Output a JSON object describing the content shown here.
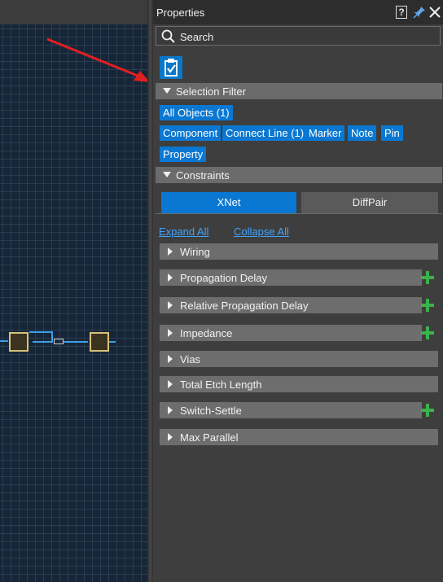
{
  "panel": {
    "title": "Properties",
    "help_glyph": "?",
    "search_label": "Search"
  },
  "selection_filter": {
    "header": "Selection Filter",
    "chips": [
      "All Objects (1)",
      "Component",
      "Connect Line (1)",
      "Marker",
      "Note",
      "Pin",
      "Property"
    ]
  },
  "constraints": {
    "header": "Constraints",
    "tabs": [
      "XNet",
      "DiffPair"
    ],
    "expand_all": "Expand All",
    "collapse_all": "Collapse All",
    "categories": [
      {
        "label": "Wiring",
        "has_add": false
      },
      {
        "label": "Propagation Delay",
        "has_add": true
      },
      {
        "label": "Relative Propagation Delay",
        "has_add": true
      },
      {
        "label": "Impedance",
        "has_add": true
      },
      {
        "label": "Vias",
        "has_add": false
      },
      {
        "label": "Total Etch Length",
        "has_add": false
      },
      {
        "label": "Switch-Settle",
        "has_add": true
      },
      {
        "label": "Max Parallel",
        "has_add": false
      }
    ]
  },
  "colors": {
    "accent": "#0a78d2",
    "add": "#3bb24a",
    "annotation_arrow": "#e02020",
    "canvas_bg": "#162638"
  },
  "icons": [
    "help-icon",
    "pin-icon",
    "close-icon",
    "search-icon",
    "clipboard-check-icon",
    "plus-icon",
    "triangle-down-icon",
    "triangle-right-icon"
  ]
}
